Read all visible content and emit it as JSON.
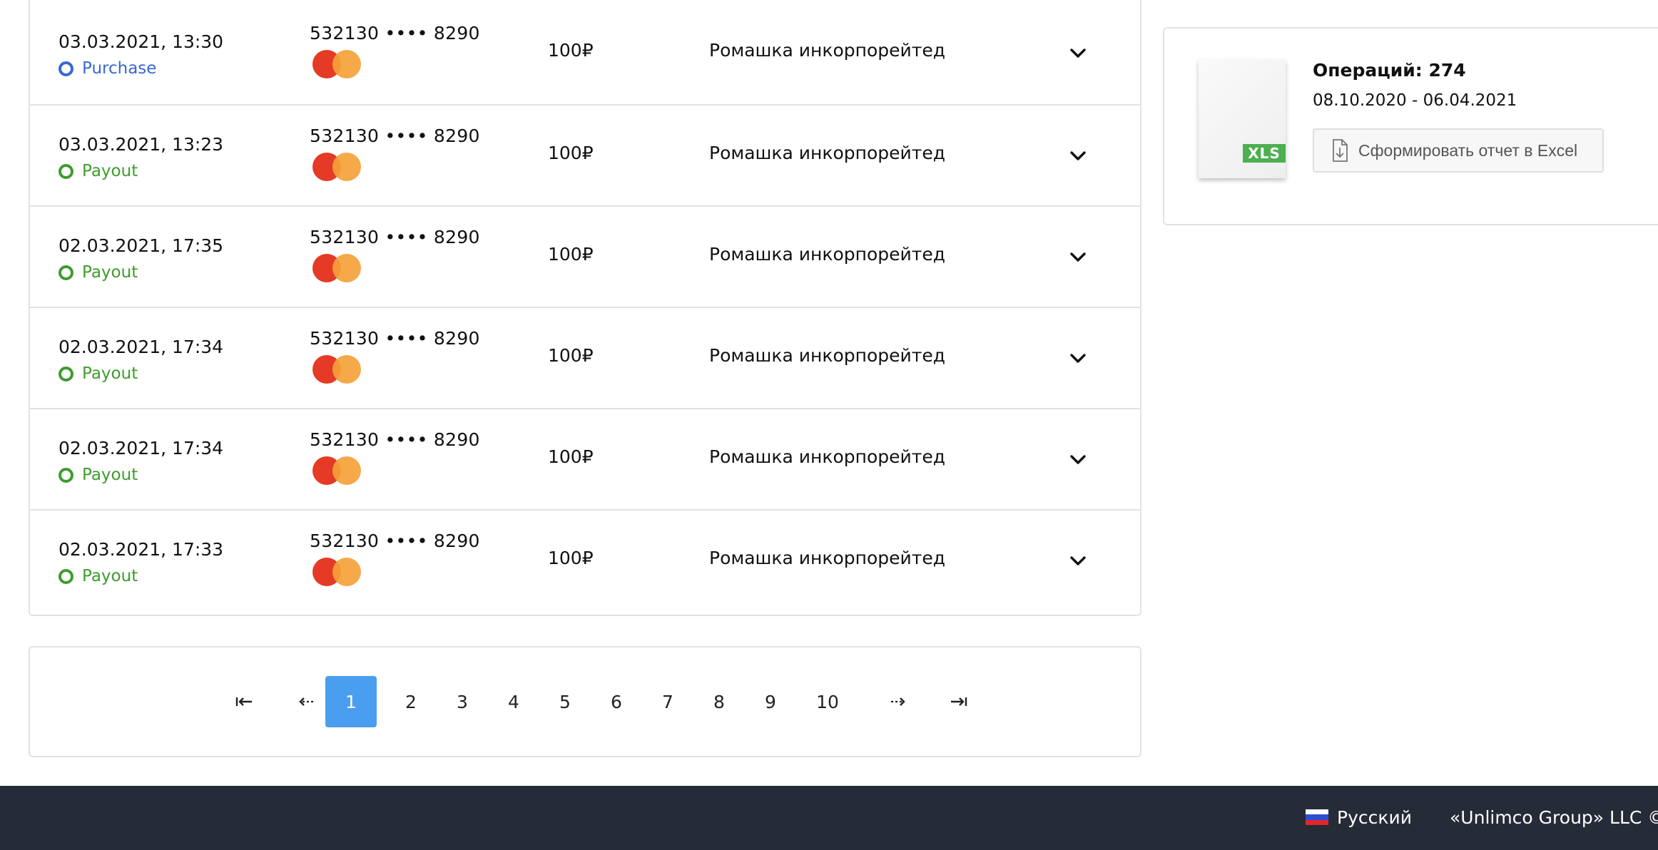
{
  "transactions": [
    {
      "date": "03.03.2021, 13:30",
      "status": "Purchase",
      "card": "532130 •••• 8290",
      "amount": "100₽",
      "merchant": "Ромашка инкорпорейтед"
    },
    {
      "date": "03.03.2021, 13:23",
      "status": "Payout",
      "card": "532130 •••• 8290",
      "amount": "100₽",
      "merchant": "Ромашка инкорпорейтед"
    },
    {
      "date": "02.03.2021, 17:35",
      "status": "Payout",
      "card": "532130 •••• 8290",
      "amount": "100₽",
      "merchant": "Ромашка инкорпорейтед"
    },
    {
      "date": "02.03.2021, 17:34",
      "status": "Payout",
      "card": "532130 •••• 8290",
      "amount": "100₽",
      "merchant": "Ромашка инкорпорейтед"
    },
    {
      "date": "02.03.2021, 17:34",
      "status": "Payout",
      "card": "532130 •••• 8290",
      "amount": "100₽",
      "merchant": "Ромашка инкорпорейтед"
    },
    {
      "date": "02.03.2021, 17:33",
      "status": "Payout",
      "card": "532130 •••• 8290",
      "amount": "100₽",
      "merchant": "Ромашка инкорпорейтед"
    }
  ],
  "pagination": {
    "first_icon": "first-page-icon",
    "prev_icon": "prev-page-icon",
    "pages": [
      "1",
      "2",
      "3",
      "4",
      "5",
      "6",
      "7",
      "8",
      "9",
      "10"
    ],
    "current_page": "1",
    "next_icon": "next-page-icon",
    "last_icon": "last-page-icon"
  },
  "report": {
    "file_badge": "XLS",
    "count_label": "Операций: 274",
    "date_range": "08.10.2020 - 06.04.2021",
    "button_label": "Сформировать отчет в Excel"
  },
  "footer": {
    "language": "Русский",
    "copyright": "«Unlimco Group» LLC ©"
  },
  "colors": {
    "purchase": "#3a68d0",
    "payout": "#3f9b2e",
    "active_page": "#4a9ef0",
    "footer_bg": "#252b37",
    "xls_badge": "#4caf50"
  }
}
